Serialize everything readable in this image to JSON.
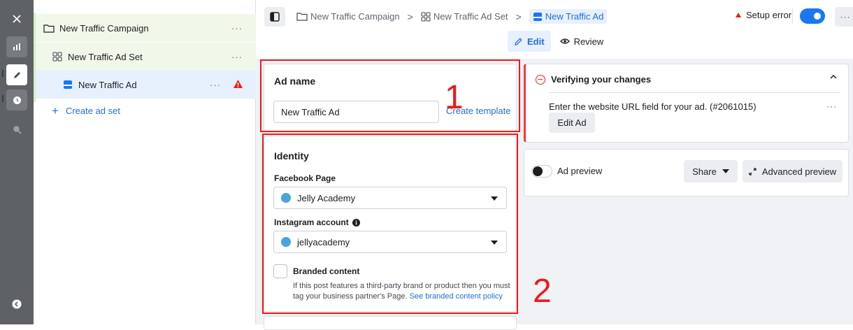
{
  "tree": {
    "campaign_label": "New Traffic Campaign",
    "adset_label": "New Traffic Ad Set",
    "ad_label": "New Traffic Ad",
    "more_label": "···",
    "create_adset_label": "Create ad set"
  },
  "topbar": {
    "breadcrumbs": [
      "New Traffic Campaign",
      "New Traffic Ad Set",
      "New Traffic Ad"
    ],
    "separator": ">",
    "setup_error_label": "Setup error",
    "publish_toggle_on": true,
    "more_label": "···",
    "tabs": [
      {
        "label": "Edit",
        "icon": "pencil-icon",
        "active": true
      },
      {
        "label": "Review",
        "icon": "eye-icon",
        "active": false
      }
    ]
  },
  "ad_name_section": {
    "title": "Ad name",
    "value": "New Traffic Ad",
    "create_template_label": "Create template"
  },
  "identity_section": {
    "title": "Identity",
    "facebook_page_label": "Facebook Page",
    "facebook_page_value": "Jelly Academy",
    "instagram_label": "Instagram account",
    "instagram_value": "jellyacademy",
    "branded_content_label": "Branded content",
    "branded_content_desc": "If this post features a third-party brand or product then you must tag your business partner's Page.",
    "branded_content_link": "See branded content policy",
    "branded_content_checked": false
  },
  "verify_panel": {
    "title": "Verifying your changes",
    "message": "Enter the website URL field for your ad. (#2061015)",
    "edit_button_label": "Edit Ad",
    "more_label": "···"
  },
  "preview_panel": {
    "toggle_on": false,
    "label": "Ad preview",
    "share_label": "Share",
    "advanced_label": "Advanced preview"
  },
  "annotations": {
    "box1_label": "1",
    "box2_label": "2"
  },
  "colors": {
    "accent_blue": "#1877f2",
    "link_blue": "#216fdb",
    "error_red": "#e5231b",
    "annotation_red": "#e81c1c",
    "rail_grey": "#5e6266",
    "campaign_green_tint": "#f0f8ea",
    "ad_blue_tint": "#e7f0fd"
  }
}
